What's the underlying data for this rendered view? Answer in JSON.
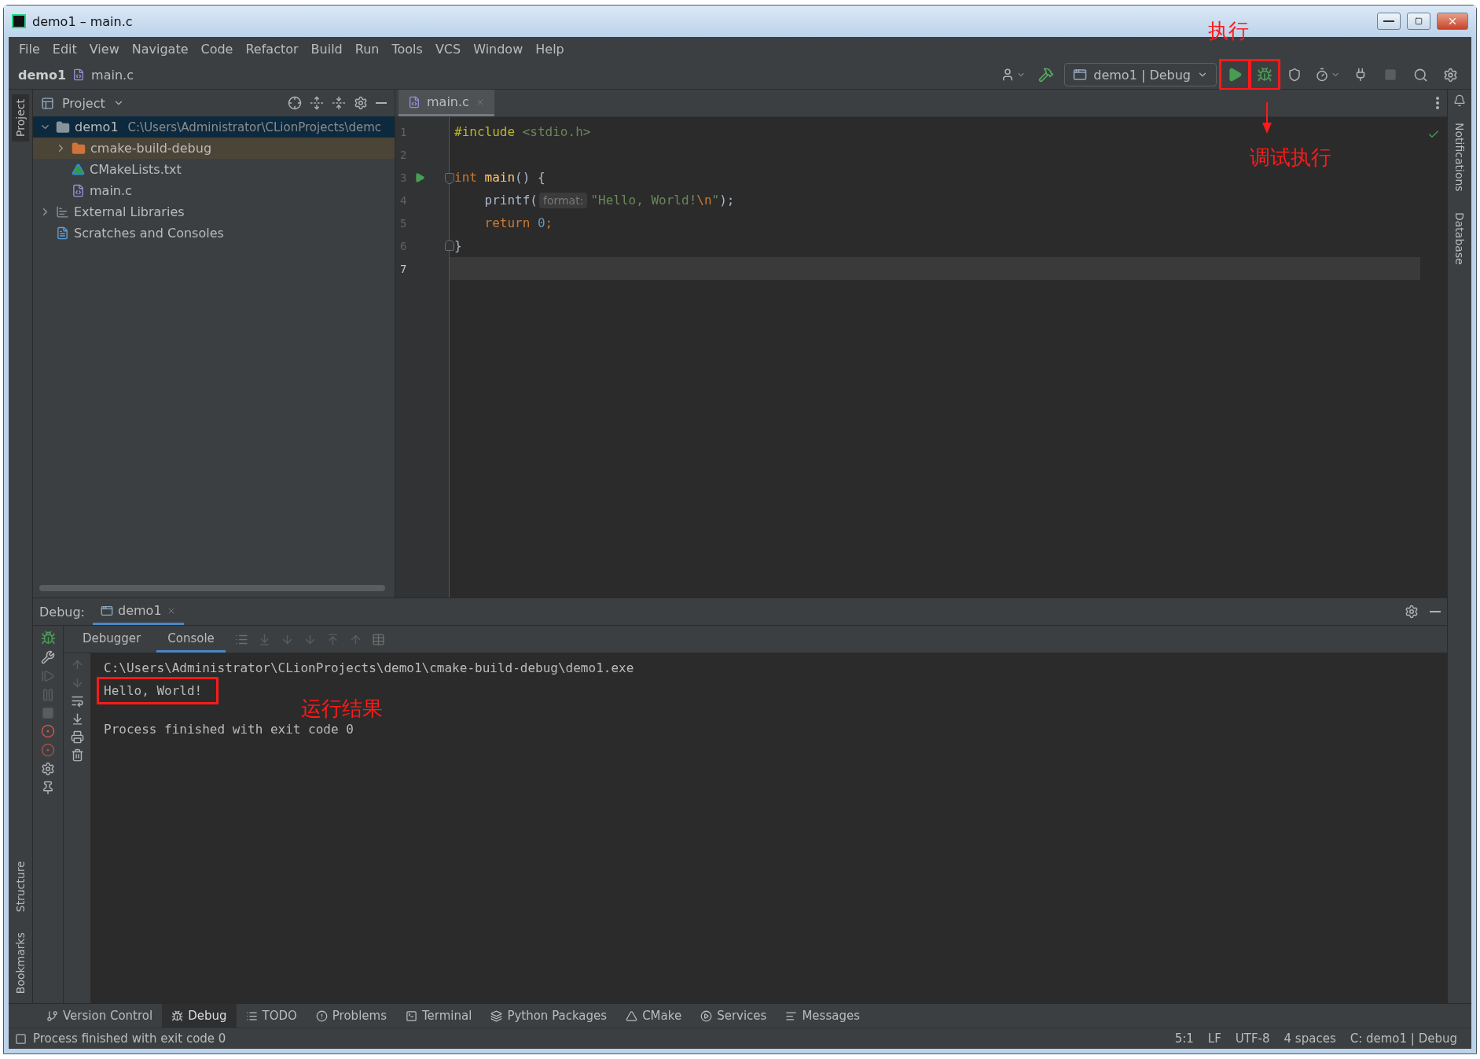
{
  "window": {
    "title": "demo1 – main.c"
  },
  "menu": [
    "File",
    "Edit",
    "View",
    "Navigate",
    "Code",
    "Refactor",
    "Build",
    "Run",
    "Tools",
    "VCS",
    "Window",
    "Help"
  ],
  "breadcrumb": [
    "demo1",
    "main.c"
  ],
  "toolbar": [
    {
      "kind": "user"
    },
    {
      "kind": "build"
    },
    {
      "kind": "config",
      "label": "demo1 | Debug"
    },
    {
      "kind": "run",
      "boxed": true
    },
    {
      "kind": "debug",
      "boxed": true
    },
    {
      "kind": "coverage"
    },
    {
      "kind": "profile"
    },
    {
      "kind": "attach"
    },
    {
      "kind": "stop"
    },
    {
      "kind": "search"
    },
    {
      "kind": "settings"
    }
  ],
  "left_strip": {
    "top": [
      {
        "label": "Project",
        "selected": true
      }
    ],
    "bottom": [
      {
        "label": "Structure",
        "selected": false
      },
      {
        "label": "Bookmarks",
        "selected": false
      }
    ]
  },
  "right_strip": [
    {
      "label": "Notifications",
      "selected": false
    },
    {
      "label": "Database",
      "selected": false
    }
  ],
  "project_panel": {
    "title": "Project",
    "tree": [
      {
        "label": "demo1",
        "path": "C:\\Users\\Administrator\\CLionProjects\\demc",
        "kind": "folder",
        "expanded": true,
        "selected": true,
        "children": [
          {
            "label": "cmake-build-debug",
            "kind": "excluded-folder",
            "expanded": false,
            "selected": false
          },
          {
            "label": "CMakeLists.txt",
            "kind": "cmake",
            "selected": false
          },
          {
            "label": "main.c",
            "kind": "c-file",
            "selected": false
          }
        ]
      },
      {
        "label": "External Libraries",
        "kind": "libraries",
        "expanded": false,
        "selected": false
      },
      {
        "label": "Scratches and Consoles",
        "kind": "scratches",
        "selected": false
      }
    ]
  },
  "editor": {
    "tabs": [
      {
        "label": "main.c",
        "selected": true
      }
    ],
    "lines": [
      {
        "number": "1",
        "tokens": [
          {
            "kind": "directive",
            "text": "#include"
          },
          {
            "kind": "header",
            "text": " <stdio.h>"
          }
        ]
      },
      {
        "number": "2"
      },
      {
        "number": "3",
        "run_marker": true,
        "fold_start": true,
        "tokens": [
          {
            "kind": "keyword",
            "text": "int"
          },
          {
            "kind": "function",
            "text": " main"
          },
          {
            "kind": "plain",
            "text": "() {"
          }
        ]
      },
      {
        "number": "4",
        "tokens": [
          {
            "kind": "plain",
            "text": "    printf("
          },
          {
            "kind": "hint",
            "text": "format:"
          },
          {
            "kind": "string",
            "text": "\"Hello, World!"
          },
          {
            "kind": "escape",
            "text": "\\n"
          },
          {
            "kind": "string",
            "text": "\""
          },
          {
            "kind": "plain",
            "text": ");"
          }
        ]
      },
      {
        "number": "5",
        "tokens": [
          {
            "kind": "keyword",
            "text": "    return"
          },
          {
            "kind": "number",
            "text": " 0"
          },
          {
            "kind": "keyword",
            "text": ";"
          }
        ]
      },
      {
        "number": "6",
        "fold_end": true,
        "tokens": [
          {
            "kind": "plain",
            "text": "}"
          }
        ]
      },
      {
        "number": "7",
        "current": true
      }
    ]
  },
  "debug_panel": {
    "label": "Debug:",
    "tabs": [
      {
        "label": "demo1",
        "selected": true
      }
    ],
    "subtabs": [
      {
        "label": "Debugger",
        "selected": false
      },
      {
        "label": "Console",
        "selected": true
      }
    ],
    "console": [
      {
        "text": "C:\\Users\\Administrator\\CLionProjects\\demo1\\cmake-build-debug\\demo1.exe",
        "boxed": false,
        "spaced": false
      },
      {
        "text": "Hello, World!",
        "boxed": true,
        "spaced": false
      },
      {
        "text": "Process finished with exit code 0",
        "boxed": false,
        "spaced": true
      }
    ]
  },
  "tool_tabs": [
    {
      "label": "Version Control",
      "kind": "vcs",
      "selected": false
    },
    {
      "label": "Debug",
      "kind": "debug",
      "selected": true
    },
    {
      "label": "TODO",
      "kind": "todo",
      "selected": false
    },
    {
      "label": "Problems",
      "kind": "problems",
      "selected": false
    },
    {
      "label": "Terminal",
      "kind": "terminal",
      "selected": false
    },
    {
      "label": "Python Packages",
      "kind": "packages",
      "selected": false
    },
    {
      "label": "CMake",
      "kind": "cmake",
      "selected": false
    },
    {
      "label": "Services",
      "kind": "services",
      "selected": false
    },
    {
      "label": "Messages",
      "kind": "messages",
      "selected": false
    }
  ],
  "status_bar": {
    "message": "Process finished with exit code 0",
    "items": [
      "5:1",
      "LF",
      "UTF-8",
      "4 spaces",
      "C: demo1 | Debug"
    ]
  },
  "annotations": [
    {
      "text": "执行"
    },
    {
      "text": "调试执行"
    },
    {
      "text": "运行结果"
    }
  ]
}
